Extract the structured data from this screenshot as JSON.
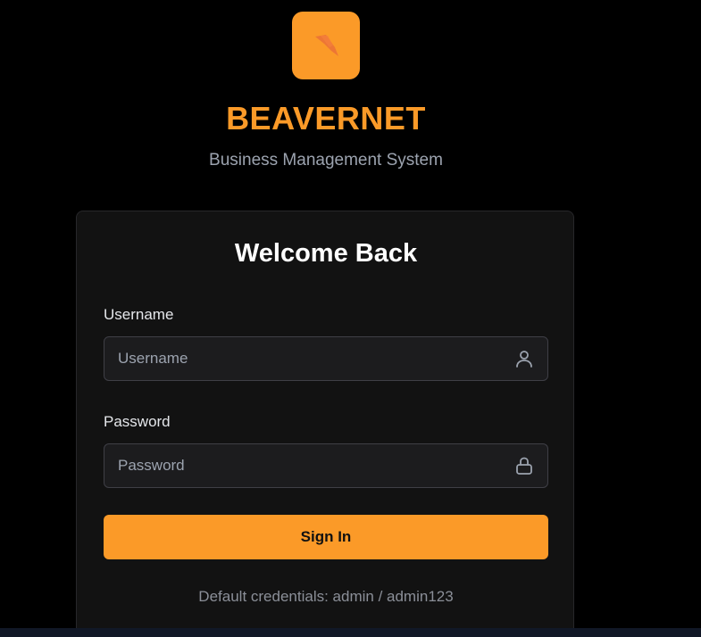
{
  "brand": {
    "name": "BEAVERNET",
    "tagline": "Business Management System",
    "accent_color": "#fb9a28",
    "logo_icon": "beaver-logo-icon"
  },
  "login": {
    "title": "Welcome Back",
    "username": {
      "label": "Username",
      "placeholder": "Username",
      "value": "",
      "icon": "user-icon"
    },
    "password": {
      "label": "Password",
      "placeholder": "Password",
      "value": "",
      "icon": "lock-icon"
    },
    "submit_label": "Sign In",
    "hint": "Default credentials: admin / admin123"
  }
}
